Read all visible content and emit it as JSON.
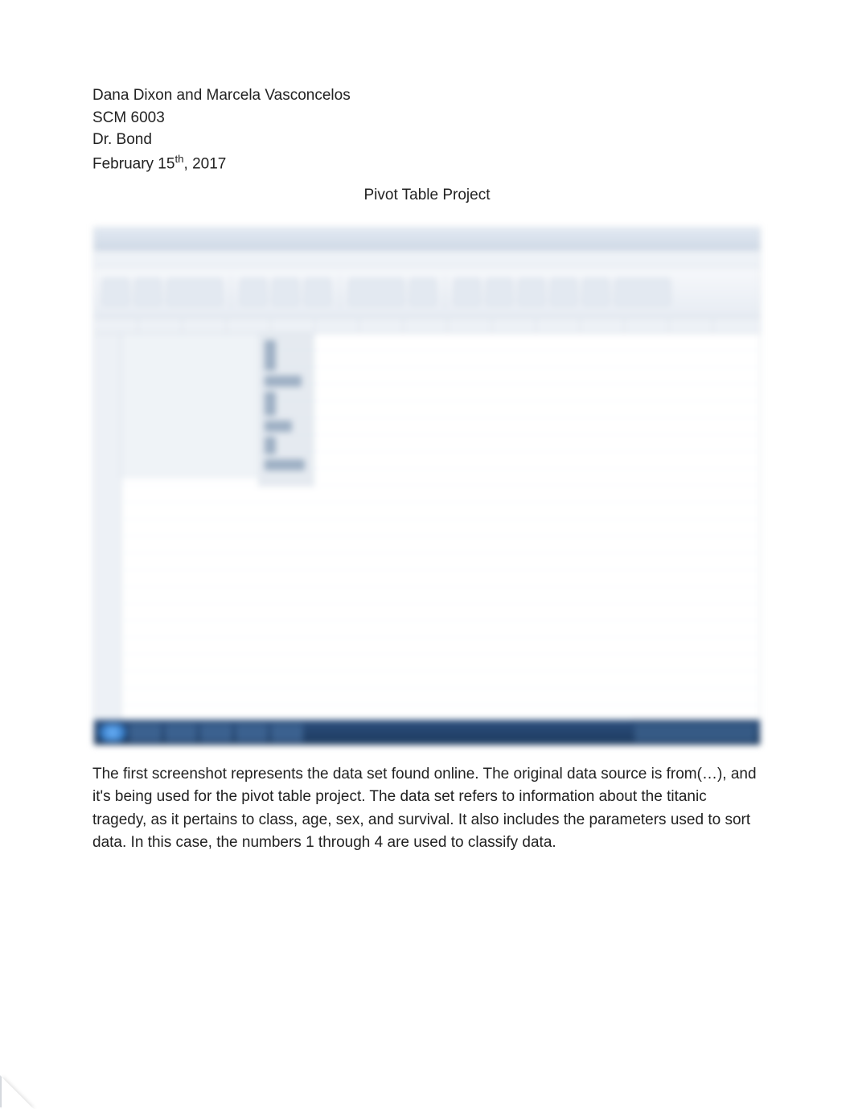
{
  "header": {
    "authors": "Dana Dixon and Marcela Vasconcelos",
    "course": "SCM 6003",
    "instructor": "Dr. Bond",
    "date_prefix": "February 15",
    "date_ordinal": "th",
    "date_suffix": ", 2017"
  },
  "title": "Pivot Table Project",
  "paragraph": "The first screenshot represents the data set found online. The original data source is from(…), and it's being used for the pivot table project. The data set refers to information about the titanic tragedy, as it pertains to class, age, sex, and survival.  It also includes the parameters used to sort data. In this case, the numbers 1 through 4 are used to classify data."
}
